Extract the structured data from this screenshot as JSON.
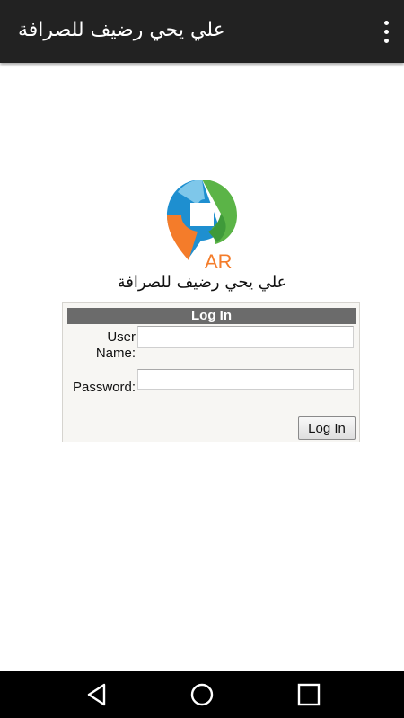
{
  "app": {
    "title": "علي يحي رضيف للصرافة"
  },
  "icons": {
    "overflow": "overflow-menu-icon",
    "back": "back-icon",
    "home": "home-icon",
    "recent": "recent-apps-icon"
  },
  "logo": {
    "text": "AR"
  },
  "company_name": "علي يحي رضيف للصرافة",
  "login": {
    "header": "Log In",
    "user_label_line1": "User",
    "user_label_line2": "Name:",
    "password_label": "Password:",
    "username_value": "",
    "password_value": "",
    "button_label": "Log In"
  },
  "colors": {
    "appbar": "#222222",
    "login_header": "#6b6b6b",
    "logo_orange": "#f47c2a",
    "logo_blue": "#1e8fd0",
    "logo_green": "#5bb447"
  }
}
